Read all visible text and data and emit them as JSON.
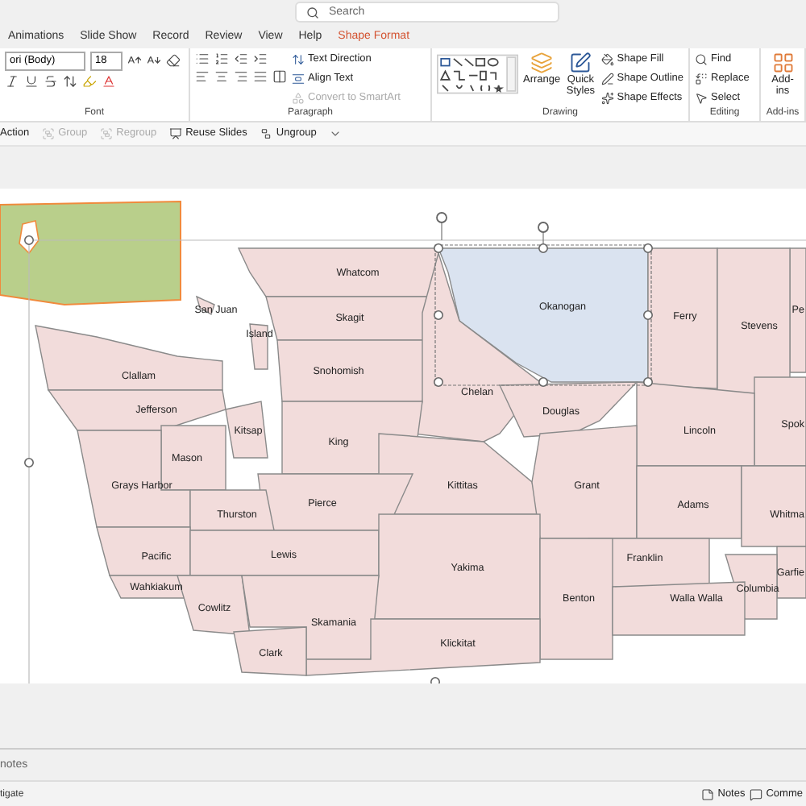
{
  "search": {
    "placeholder": "Search"
  },
  "tabs": [
    {
      "label": "Animations",
      "selected": false
    },
    {
      "label": "Slide Show",
      "selected": false
    },
    {
      "label": "Record",
      "selected": false
    },
    {
      "label": "Review",
      "selected": false
    },
    {
      "label": "View",
      "selected": false
    },
    {
      "label": "Help",
      "selected": false
    },
    {
      "label": "Shape Format",
      "selected": true
    }
  ],
  "ribbon": {
    "font": {
      "label": "Font",
      "name": "ori (Body)",
      "size": "18"
    },
    "paragraph": {
      "label": "Paragraph",
      "commands": [
        {
          "label": "Text Direction",
          "disabled": false
        },
        {
          "label": "Align Text",
          "disabled": false
        },
        {
          "label": "Convert to SmartArt",
          "disabled": true
        }
      ]
    },
    "drawing": {
      "label": "Drawing",
      "arrange": "Arrange",
      "quick_styles": "Quick Styles",
      "commands": [
        "Shape Fill",
        "Shape Outline",
        "Shape Effects"
      ]
    },
    "editing": {
      "label": "Editing",
      "commands": [
        "Find",
        "Replace",
        "Select"
      ]
    },
    "addins": {
      "label": "Add-ins",
      "button": "Add-ins"
    }
  },
  "quick_access": [
    {
      "label": "Action",
      "disabled": false
    },
    {
      "label": "Group",
      "disabled": true
    },
    {
      "label": "Regroup",
      "disabled": true
    },
    {
      "label": "Reuse Slides",
      "disabled": false
    },
    {
      "label": "Ungroup",
      "disabled": false
    }
  ],
  "counties": [
    {
      "name": "Whatcom",
      "selected": false
    },
    {
      "name": "San Juan",
      "selected": false
    },
    {
      "name": "Okanogan",
      "selected": true
    },
    {
      "name": "Pe",
      "selected": false
    },
    {
      "name": "Ferry",
      "selected": false
    },
    {
      "name": "Skagit",
      "selected": false
    },
    {
      "name": "Stevens",
      "selected": false
    },
    {
      "name": "Island",
      "selected": false
    },
    {
      "name": "Snohomish",
      "selected": false
    },
    {
      "name": "Clallam",
      "selected": false
    },
    {
      "name": "Chelan",
      "selected": false
    },
    {
      "name": "Jefferson",
      "selected": false
    },
    {
      "name": "Douglas",
      "selected": false
    },
    {
      "name": "Spok",
      "selected": false
    },
    {
      "name": "Kitsap",
      "selected": false
    },
    {
      "name": "Lincoln",
      "selected": false
    },
    {
      "name": "King",
      "selected": false
    },
    {
      "name": "Mason",
      "selected": false
    },
    {
      "name": "Grays Harbor",
      "selected": false
    },
    {
      "name": "Kittitas",
      "selected": false
    },
    {
      "name": "Grant",
      "selected": false
    },
    {
      "name": "Pierce",
      "selected": false
    },
    {
      "name": "Adams",
      "selected": false
    },
    {
      "name": "Thurston",
      "selected": false
    },
    {
      "name": "Whitma",
      "selected": false
    },
    {
      "name": "Pacific",
      "selected": false
    },
    {
      "name": "Lewis",
      "selected": false
    },
    {
      "name": "Franklin",
      "selected": false
    },
    {
      "name": "Yakima",
      "selected": false
    },
    {
      "name": "Garfie",
      "selected": false
    },
    {
      "name": "Wahkiakum",
      "selected": false
    },
    {
      "name": "Columbia",
      "selected": false
    },
    {
      "name": "Benton",
      "selected": false
    },
    {
      "name": "Walla Walla",
      "selected": false
    },
    {
      "name": "Cowlitz",
      "selected": false
    },
    {
      "name": "Skamania",
      "selected": false
    },
    {
      "name": "Klickitat",
      "selected": false
    },
    {
      "name": "Clark",
      "selected": false
    }
  ],
  "notes_hint": "notes",
  "status_bar": {
    "left": "tigate",
    "notes": "Notes",
    "comments": "Comme"
  }
}
